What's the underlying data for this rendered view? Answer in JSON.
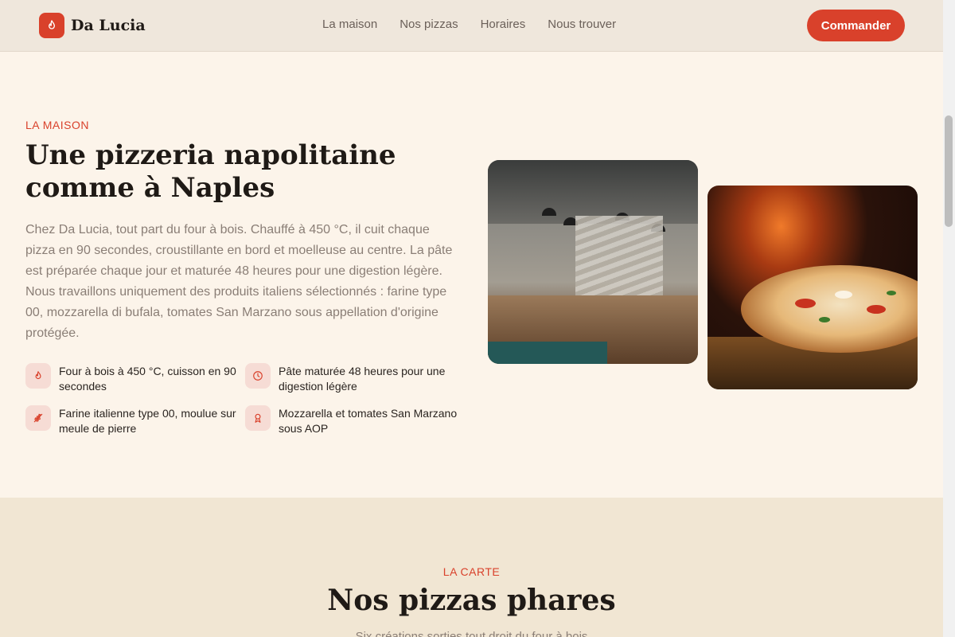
{
  "header": {
    "brand": "Da Lucia",
    "logo_icon": "flame-icon",
    "nav": [
      "La maison",
      "Nos pizzas",
      "Horaires",
      "Nous trouver"
    ],
    "cta": "Commander"
  },
  "hero": {
    "eyebrow": "LA MAISON",
    "title": "Une pizzeria napolitaine comme à Naples",
    "description": "Chez Da Lucia, tout part du four à bois. Chauffé à 450 °C, il cuit chaque pizza en 90 secondes, croustillante en bord et moelleuse au centre. La pâte est préparée chaque jour et maturée 48 heures pour une digestion légère. Nous travaillons uniquement des produits italiens sélectionnés : farine type 00, mozzarella di bufala, tomates San Marzano sous appellation d'origine protégée.",
    "features": [
      {
        "icon": "flame-icon",
        "text": "Four à bois à 450 °C, cuisson en 90 secondes"
      },
      {
        "icon": "clock-icon",
        "text": "Pâte maturée 48 heures pour une digestion légère"
      },
      {
        "icon": "wheat-icon",
        "text": "Farine italienne type 00, moulue sur meule de pierre"
      },
      {
        "icon": "award-icon",
        "text": "Mozzarella et tomates San Marzano sous AOP"
      }
    ]
  },
  "carte": {
    "eyebrow": "LA CARTE",
    "title": "Nos pizzas phares",
    "subtitle": "Six créations sorties tout droit du four à bois"
  },
  "colors": {
    "accent": "#d9412b",
    "background": "#fcf4ea",
    "header_bg": "#efe7dc",
    "section_bg": "#f1e6d3"
  }
}
